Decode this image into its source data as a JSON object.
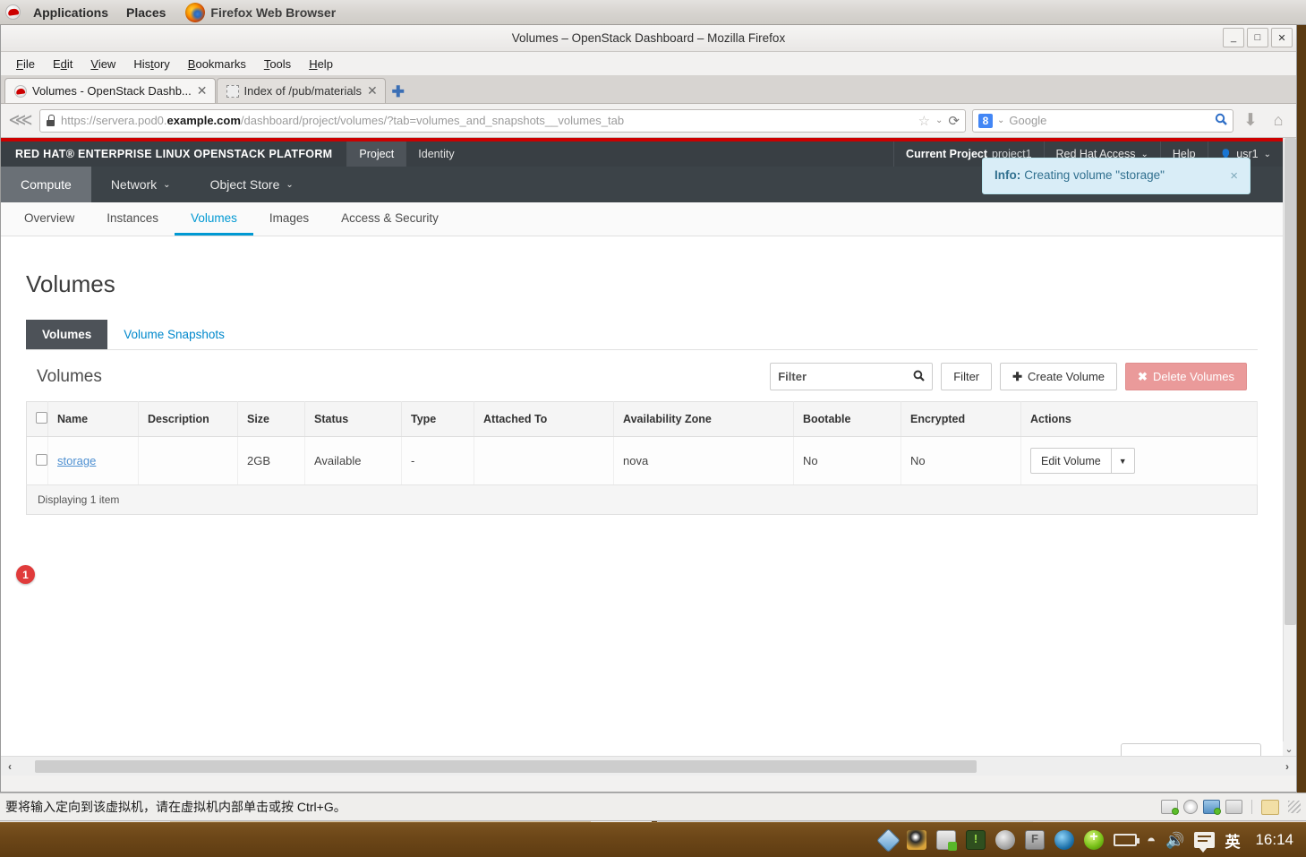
{
  "desktop": {
    "applications_label": "Applications",
    "places_label": "Places",
    "firefox_task_label": "Firefox Web Browser"
  },
  "window": {
    "title": "Volumes – OpenStack Dashboard – Mozilla Firefox",
    "minimize": "_",
    "maximize": "□",
    "close": "✕"
  },
  "menubar": [
    {
      "label": "File"
    },
    {
      "label": "Edit"
    },
    {
      "label": "View"
    },
    {
      "label": "History"
    },
    {
      "label": "Bookmarks"
    },
    {
      "label": "Tools"
    },
    {
      "label": "Help"
    }
  ],
  "tabs": [
    {
      "title": "Volumes - OpenStack Dashb...",
      "active": true,
      "close": "✕"
    },
    {
      "title": "Index of /pub/materials",
      "active": false,
      "close": "✕"
    }
  ],
  "newtab_label": "✚",
  "urlbar": {
    "scheme": "https://servera.pod0.",
    "domain": "example.com",
    "path": "/dashboard/project/volumes/?tab=volumes_and_snapshots__volumes_tab",
    "star": "☆",
    "caret": "⌄",
    "reload": "⟳"
  },
  "searchbar": {
    "engine_badge": "8",
    "caret": "⌄",
    "placeholder": "Google",
    "magnifier": "🔍"
  },
  "toolbar_icons": {
    "back": "⋘",
    "download": "⬇",
    "home": "⌂"
  },
  "openstack": {
    "brand": "RED HAT® ENTERPRISE LINUX OPENSTACK PLATFORM",
    "topnav": [
      {
        "label": "Project",
        "active": true
      },
      {
        "label": "Identity",
        "active": false
      }
    ],
    "current_project_label": "Current Project",
    "current_project_value": "project1",
    "red_hat_access": "Red Hat Access",
    "help": "Help",
    "user": "usr1",
    "caret": "⌄",
    "secondnav": [
      {
        "label": "Compute",
        "active": true,
        "caret": ""
      },
      {
        "label": "Network",
        "active": false,
        "caret": "⌄"
      },
      {
        "label": "Object Store",
        "active": false,
        "caret": "⌄"
      }
    ],
    "subnav": [
      {
        "label": "Overview",
        "active": false
      },
      {
        "label": "Instances",
        "active": false
      },
      {
        "label": "Volumes",
        "active": true
      },
      {
        "label": "Images",
        "active": false
      },
      {
        "label": "Access & Security",
        "active": false
      }
    ]
  },
  "alert": {
    "prefix": "Info:",
    "message": "Creating volume \"storage\"",
    "close": "×"
  },
  "main": {
    "page_title": "Volumes",
    "tabs": [
      {
        "label": "Volumes",
        "active": true
      },
      {
        "label": "Volume Snapshots",
        "active": false
      }
    ],
    "table_heading": "Volumes",
    "filter_placeholder": "Filter",
    "filter_button": "Filter",
    "create_button": "Create Volume",
    "create_icon": "✚",
    "delete_button": "Delete Volumes",
    "delete_icon": "✖",
    "columns": [
      "Name",
      "Description",
      "Size",
      "Status",
      "Type",
      "Attached To",
      "Availability Zone",
      "Bootable",
      "Encrypted",
      "Actions"
    ],
    "rows": [
      {
        "name": "storage",
        "description": "",
        "size": "2GB",
        "status": "Available",
        "type": "-",
        "attached_to": "",
        "availability_zone": "nova",
        "bootable": "No",
        "encrypted": "No",
        "action_label": "Edit Volume",
        "action_caret": "▼"
      }
    ],
    "footer": "Displaying 1 item"
  },
  "annotation": {
    "badge": "1"
  },
  "vm_statusbar": {
    "message": "要将输入定向到该虚拟机，请在虚拟机内部单击或按 Ctrl+G。"
  },
  "taskbar": {
    "ime_label": "英",
    "clock": "16:14"
  },
  "colors": {
    "redhat_red": "#cc0000",
    "nav_dark": "#393f44",
    "accent_blue": "#0099d3",
    "link_blue": "#4d8fd1",
    "alert_bg": "#d9edf7",
    "alert_text": "#31708f",
    "danger": "#ea9a9a",
    "badge_red": "#e03b3b",
    "taskbar_brown": "#6d4718"
  }
}
